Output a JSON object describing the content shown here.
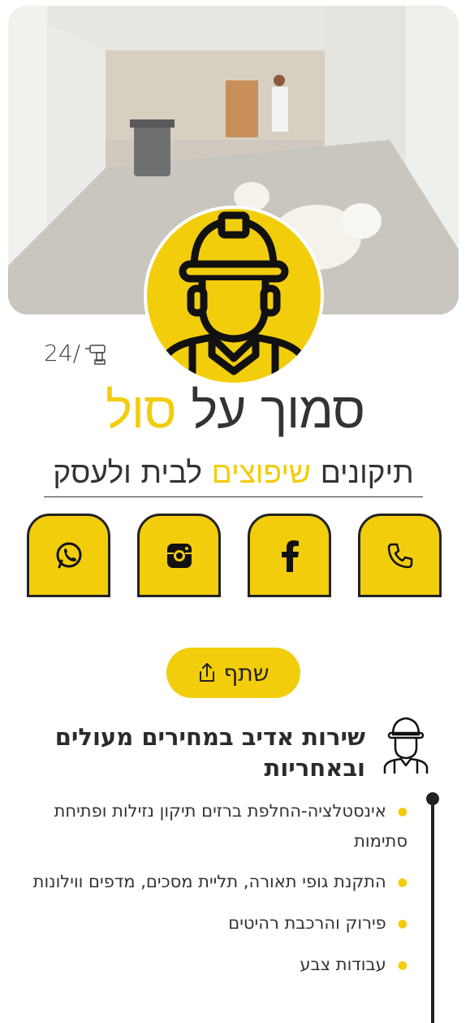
{
  "counter": {
    "value": "24/"
  },
  "title": {
    "part1": "סמוך על",
    "part2": "סול"
  },
  "subtitle": {
    "part1": "תיקונים",
    "part2": "שיפוצים",
    "part3": "לבית ולעסק"
  },
  "social": [
    "phone-icon",
    "facebook-icon",
    "instagram-icon",
    "whatsapp-icon"
  ],
  "share": {
    "label": "שתף"
  },
  "section": {
    "title": "שירות אדיב במחירים מעולים ובאחריות"
  },
  "services": [
    "אינסטלציה-החלפת ברזים תיקון נזילות ופתיחת סתימות",
    "התקנת גופי תאורה, תליית מסכים, מדפים ווילונות",
    "פירוק והרכבת רהיטים",
    "עבודות צבע"
  ],
  "colors": {
    "accent": "#f2cd0b",
    "dark": "#222222"
  }
}
